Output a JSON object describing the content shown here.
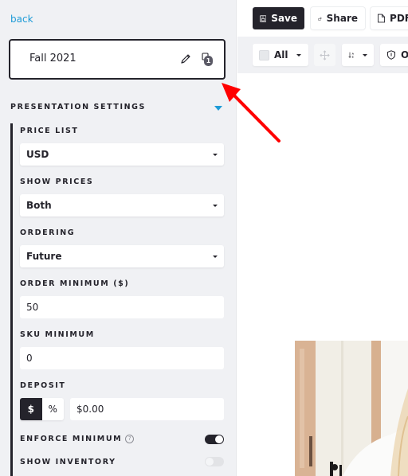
{
  "sidebar": {
    "back_label": "back",
    "presentation_title": "Fall 2021",
    "duplicate_badge": "1",
    "section_title": "PRESENTATION SETTINGS",
    "fields": {
      "price_list": {
        "label": "PRICE LIST",
        "value": "USD"
      },
      "show_prices": {
        "label": "SHOW PRICES",
        "value": "Both"
      },
      "ordering": {
        "label": "ORDERING",
        "value": "Future"
      },
      "order_minimum": {
        "label": "ORDER MINIMUM ($)",
        "value": "50"
      },
      "sku_minimum": {
        "label": "SKU MINIMUM",
        "value": "0"
      },
      "deposit": {
        "label": "DEPOSIT",
        "options": [
          "$",
          "%"
        ],
        "selected": "$",
        "value": "$0.00"
      }
    },
    "toggles": {
      "enforce_minimum": {
        "label": "ENFORCE MINIMUM",
        "help": "?",
        "on": true
      },
      "show_inventory": {
        "label": "SHOW INVENTORY",
        "on": false
      }
    }
  },
  "toolbar": {
    "save_label": "Save",
    "share_label": "Share",
    "pdf_label": "PDF",
    "select_all_label": "All",
    "o_label": "O"
  },
  "colors": {
    "accent": "#1e9bd7",
    "dark": "#24232b",
    "sidebar_bg": "#f0f1f4",
    "annotation_arrow": "#ff0000"
  }
}
